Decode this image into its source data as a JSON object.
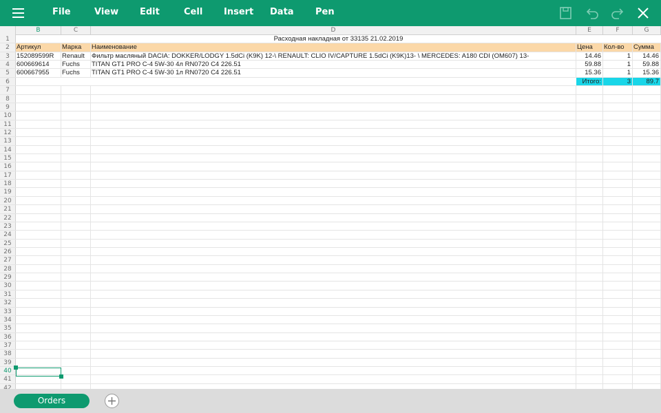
{
  "toolbar": {
    "menu": [
      "File",
      "View",
      "Edit",
      "Cell",
      "Insert",
      "Data",
      "Pen"
    ],
    "icons": [
      "menu-icon",
      "save-icon",
      "undo-icon",
      "redo-icon",
      "close-icon"
    ],
    "accent_color": "#0e9a6f"
  },
  "columns": [
    "B",
    "C",
    "D",
    "E",
    "F",
    "G"
  ],
  "active_column": "B",
  "active_row": "40",
  "sheet": {
    "title": "Расходная накладная от 33135 21.02.2019",
    "headers": {
      "article": "Артикул",
      "brand": "Марка",
      "name": "Наименование",
      "price": "Цена",
      "qty": "Кол-во",
      "sum": "Сумма"
    },
    "items": [
      {
        "article": "152089599R",
        "brand": "Renault",
        "name": "Фильтр масляный DACIA: DOKKER/LODGY 1.5dCi (K9K) 12-\\ RENAULT: CLIO IV/CAPTURE 1.5dCi (K9K)13- \\ MERCEDES: A180 CDI (OM607) 13-",
        "price": "14.46",
        "qty": "1",
        "sum": "14.46"
      },
      {
        "article": "600669614",
        "brand": "Fuchs",
        "name": "TITAN GT1 PRO C-4 5W-30 4л RN0720 C4 226.51",
        "price": "59.88",
        "qty": "1",
        "sum": "59.88"
      },
      {
        "article": "600667955",
        "brand": "Fuchs",
        "name": "TITAN GT1 PRO C-4 5W-30 1л RN0720 C4 226.51",
        "price": "15.36",
        "qty": "1",
        "sum": "15.36"
      }
    ],
    "total": {
      "label": "Итого:",
      "qty": "3",
      "sum": "89.7"
    },
    "header_color": "#fbd8a8",
    "total_color": "#19d6e8"
  },
  "sheet_tabs": [
    "Orders"
  ]
}
